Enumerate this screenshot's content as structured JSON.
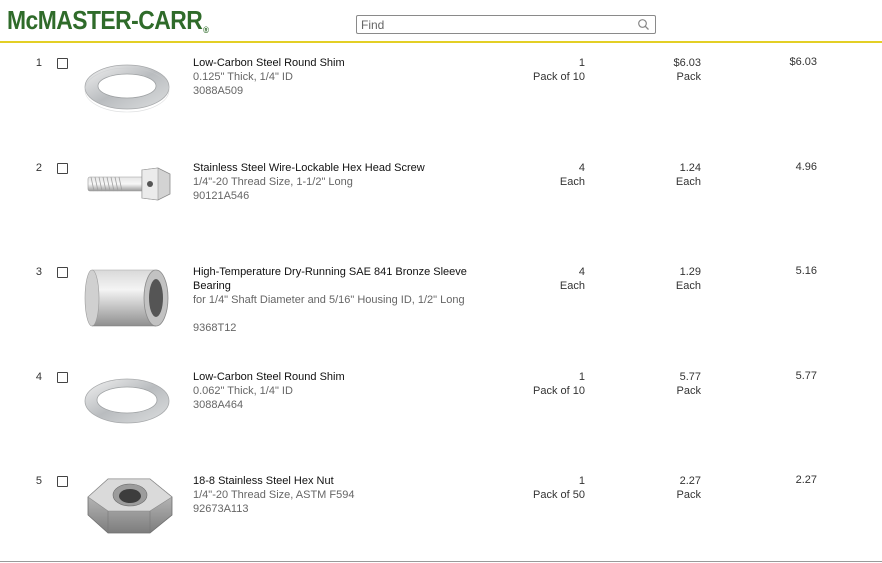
{
  "header": {
    "logo_text": "McMASTER-CARR",
    "logo_mark": "®",
    "brand_color": "#2f6b2a",
    "accent_color": "#e3cf25",
    "search": {
      "placeholder": "Find",
      "value": "",
      "icon": "search-icon"
    }
  },
  "items": [
    {
      "num": "1",
      "title": "Low-Carbon Steel Round Shim",
      "spec": "0.125\" Thick, 1/4\" ID",
      "part": "3088A509",
      "qty": "1",
      "qty_unit": "Pack of 10",
      "price": "$6.03",
      "price_unit": "Pack",
      "total": "$6.03",
      "image": "washer-icon"
    },
    {
      "num": "2",
      "title": "Stainless Steel Wire-Lockable Hex Head Screw",
      "spec": "1/4\"-20 Thread Size, 1-1/2\" Long",
      "part": "90121A546",
      "qty": "4",
      "qty_unit": "Each",
      "price": "1.24",
      "price_unit": "Each",
      "total": "4.96",
      "image": "hex-screw-icon"
    },
    {
      "num": "3",
      "title": "High-Temperature Dry-Running SAE 841 Bronze Sleeve Bearing",
      "spec": "for 1/4\" Shaft Diameter and 5/16\" Housing ID, 1/2\" Long",
      "part": "9368T12",
      "qty": "4",
      "qty_unit": "Each",
      "price": "1.29",
      "price_unit": "Each",
      "total": "5.16",
      "image": "sleeve-bearing-icon"
    },
    {
      "num": "4",
      "title": "Low-Carbon Steel Round Shim",
      "spec": "0.062\" Thick, 1/4\" ID",
      "part": "3088A464",
      "qty": "1",
      "qty_unit": "Pack of 10",
      "price": "5.77",
      "price_unit": "Pack",
      "total": "5.77",
      "image": "washer-icon"
    },
    {
      "num": "5",
      "title": "18-8 Stainless Steel Hex Nut",
      "spec": "1/4\"-20 Thread Size, ASTM F594",
      "part": "92673A113",
      "qty": "1",
      "qty_unit": "Pack of 50",
      "price": "2.27",
      "price_unit": "Pack",
      "total": "2.27",
      "image": "hex-nut-icon"
    }
  ]
}
